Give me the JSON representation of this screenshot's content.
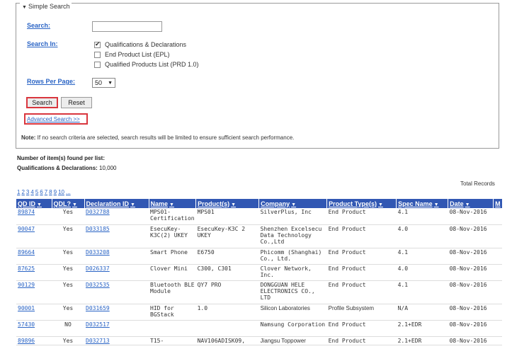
{
  "simple_search": {
    "legend": "Simple Search",
    "search_label": "Search:",
    "search_value": "",
    "search_in_label": "Search In:",
    "options": [
      {
        "label": "Qualifications & Declarations",
        "checked": true
      },
      {
        "label": "End Product List (EPL)",
        "checked": false
      },
      {
        "label": "Qualified Products List (PRD 1.0)",
        "checked": false
      }
    ],
    "rows_label": "Rows Per Page:",
    "rows_value": "50",
    "search_button": "Search",
    "reset_button": "Reset",
    "advanced_link": "Advanced Search >>",
    "note_bold": "Note:",
    "note_text": " If no search criteria are selected, search results will be limited to ensure sufficient search performance."
  },
  "results": {
    "found_label": "Number of item(s) found per list:",
    "qd_label": "Qualifications & Declarations:",
    "qd_count": " 10,000",
    "total_label": "Total Records",
    "pages": [
      "1",
      "2",
      "3",
      "4",
      "5",
      "6",
      "7",
      "8",
      "9",
      "10",
      "..."
    ],
    "columns": [
      "QD ID",
      "QDL?",
      "Declaration ID",
      "Name",
      "Product(s)",
      "Company",
      "Product Type(s)",
      "Spec Name",
      "Date",
      "M"
    ],
    "rows": [
      {
        "qd": "89874",
        "qdl": "Yes",
        "decl": "D032788",
        "name": "MPS01-Certification",
        "product": "MPS01",
        "company": "SilverPlus, Inc",
        "type": "End Product",
        "spec": "4.1",
        "date": "08-Nov-2016"
      },
      {
        "qd": "90047",
        "qdl": "Yes",
        "decl": "D033185",
        "name": "EsecuKey-K3C(2) UKEY",
        "product": "EsecuKey-K3C 2 UKEY",
        "company": "Shenzhen Excelsecu Data Technology Co.,Ltd",
        "type": "End Product",
        "spec": "4.0",
        "date": "08-Nov-2016"
      },
      {
        "qd": "89664",
        "qdl": "Yes",
        "decl": "D033208",
        "name": "Smart Phone",
        "product": "E6750",
        "company": "Phicomm (Shanghai) Co., Ltd.",
        "type": "End Product",
        "spec": "4.1",
        "date": "08-Nov-2016"
      },
      {
        "qd": "87625",
        "qdl": "Yes",
        "decl": "D026337",
        "name": "Clover Mini",
        "product": "C300, C301",
        "company": "Clover Network, Inc.",
        "type": "End Product",
        "spec": "4.0",
        "date": "08-Nov-2016"
      },
      {
        "qd": "90129",
        "qdl": "Yes",
        "decl": "D032535",
        "name": "Bluetooth BLE Module",
        "product": "QY7 PRO",
        "company": "DONGGUAN HELE ELECTRONICS CO., LTD",
        "type": "End Product",
        "spec": "4.1",
        "date": "08-Nov-2016"
      },
      {
        "qd": "90001",
        "qdl": "Yes",
        "decl": "D031659",
        "name": "HID for BGStack",
        "product": "1.0",
        "company": "Silicon Laboratories",
        "type": "Profile Subsystem",
        "spec": "N/A",
        "date": "08-Nov-2016"
      },
      {
        "qd": "57430",
        "qdl": "NO",
        "decl": "D032517",
        "name": "",
        "product": "",
        "company": "Namsung Corporation",
        "type": "End Product",
        "spec": "2.1+EDR",
        "date": "08-Nov-2016"
      },
      {
        "qd": "89896",
        "qdl": "Yes",
        "decl": "D032713",
        "name": "T15-",
        "product": "NAV106ADISK09,",
        "company": "Jiangsu Toppower",
        "type": "End Product",
        "spec": "2.1+EDR",
        "date": "08-Nov-2016"
      }
    ]
  }
}
